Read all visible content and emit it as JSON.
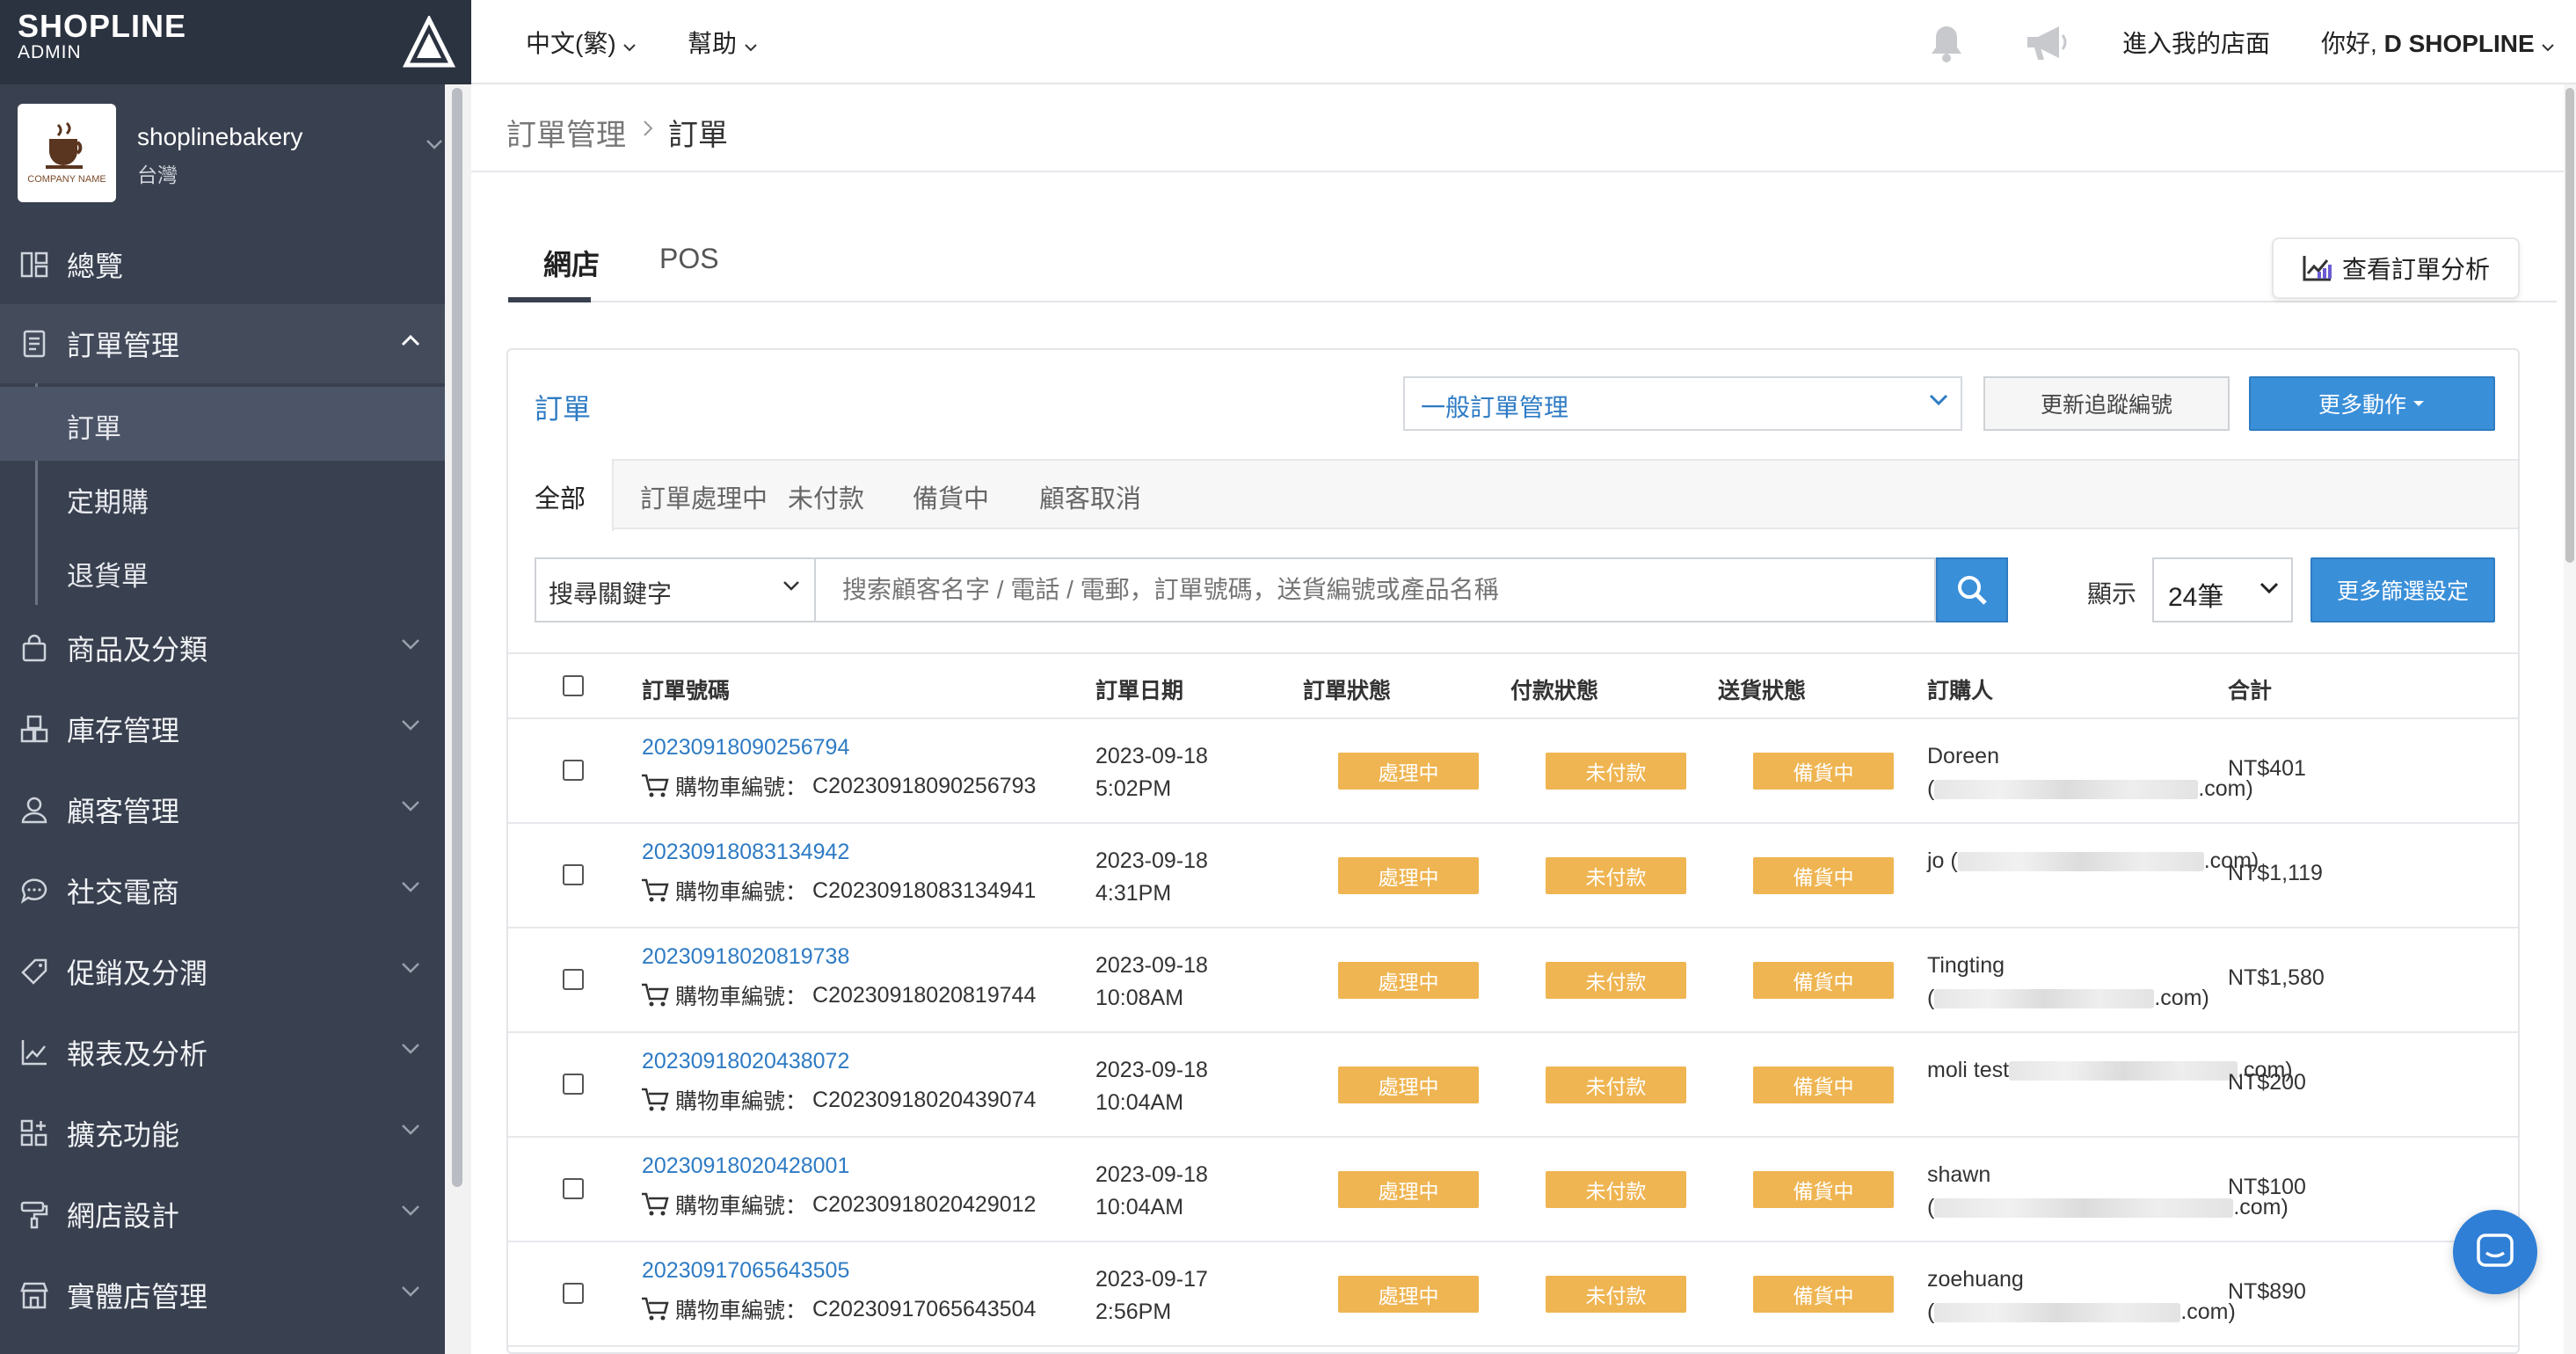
{
  "brand": {
    "name": "SHOPLINE",
    "sub": "ADMIN"
  },
  "store": {
    "name": "shoplinebakery",
    "region": "台灣",
    "logo_caption": "COMPANY NAME"
  },
  "sidebar": {
    "items": [
      {
        "label": "總覽",
        "icon": "dashboard-icon"
      },
      {
        "label": "訂單管理",
        "icon": "orders-icon"
      },
      {
        "label": "商品及分類",
        "icon": "bag-icon"
      },
      {
        "label": "庫存管理",
        "icon": "inventory-icon"
      },
      {
        "label": "顧客管理",
        "icon": "customer-icon"
      },
      {
        "label": "社交電商",
        "icon": "chat-icon"
      },
      {
        "label": "促銷及分潤",
        "icon": "tag-icon"
      },
      {
        "label": "報表及分析",
        "icon": "chart-icon"
      },
      {
        "label": "擴充功能",
        "icon": "apps-icon"
      },
      {
        "label": "網店設計",
        "icon": "paint-roller-icon"
      },
      {
        "label": "實體店管理",
        "icon": "store-icon"
      }
    ],
    "sub_items": [
      {
        "label": "訂單"
      },
      {
        "label": "定期購"
      },
      {
        "label": "退貨單"
      }
    ]
  },
  "topbar": {
    "language": "中文(繁)",
    "help": "幫助",
    "visit_store": "進入我的店面",
    "greeting_prefix": "你好,",
    "greeting_name": "D SHOPLINE"
  },
  "breadcrumb": {
    "parent": "訂單管理",
    "current": "訂單"
  },
  "channel_tabs": {
    "web": "網店",
    "pos": "POS"
  },
  "analysis_button": "查看訂單分析",
  "panel": {
    "title": "訂單",
    "mgmt_select": "一般訂單管理",
    "track_button": "更新追蹤編號",
    "more_actions": "更多動作",
    "status_tabs": [
      "全部",
      "訂單處理中",
      "未付款",
      "備貨中",
      "顧客取消"
    ],
    "search": {
      "keyword_select": "搜尋關鍵字",
      "placeholder": "搜索顧客名字 / 電話 / 電郵，訂單號碼，送貨編號或產品名稱",
      "show_label": "顯示",
      "page_size": "24筆",
      "filter_button": "更多篩選設定"
    }
  },
  "table": {
    "headers": {
      "order_no": "訂單號碼",
      "date": "訂單日期",
      "order_status": "訂單狀態",
      "payment_status": "付款狀態",
      "delivery_status": "送貨狀態",
      "buyer": "訂購人",
      "total": "合計"
    },
    "cart_prefix": "購物車編號：",
    "rows": [
      {
        "order_no": "20230918090256794",
        "cart_no": "C20230918090256793",
        "date": "2023-09-18",
        "time": "5:02PM",
        "order_status": "處理中",
        "payment_status": "未付款",
        "delivery_status": "備貨中",
        "buyer_name": "Doreen",
        "email_head": "(",
        "email_tail": ".com)",
        "total": "NT$401"
      },
      {
        "order_no": "20230918083134942",
        "cart_no": "C20230918083134941",
        "date": "2023-09-18",
        "time": "4:31PM",
        "order_status": "處理中",
        "payment_status": "未付款",
        "delivery_status": "備貨中",
        "buyer_name": "jo (",
        "email_head": "",
        "email_tail": ".com)",
        "total": "NT$1,119"
      },
      {
        "order_no": "20230918020819738",
        "cart_no": "C20230918020819744",
        "date": "2023-09-18",
        "time": "10:08AM",
        "order_status": "處理中",
        "payment_status": "未付款",
        "delivery_status": "備貨中",
        "buyer_name": "Tingting",
        "email_head": "(",
        "email_tail": ".com)",
        "total": "NT$1,580"
      },
      {
        "order_no": "20230918020438072",
        "cart_no": "C20230918020439074",
        "date": "2023-09-18",
        "time": "10:04AM",
        "order_status": "處理中",
        "payment_status": "未付款",
        "delivery_status": "備貨中",
        "buyer_name": "moli test",
        "email_head": "",
        "email_tail": ".com)",
        "total": "NT$200"
      },
      {
        "order_no": "20230918020428001",
        "cart_no": "C20230918020429012",
        "date": "2023-09-18",
        "time": "10:04AM",
        "order_status": "處理中",
        "payment_status": "未付款",
        "delivery_status": "備貨中",
        "buyer_name": "shawn",
        "email_head": "(",
        "email_tail": ".com)",
        "total": "NT$100"
      },
      {
        "order_no": "20230917065643505",
        "cart_no": "C20230917065643504",
        "date": "2023-09-17",
        "time": "2:56PM",
        "order_status": "處理中",
        "payment_status": "未付款",
        "delivery_status": "備貨中",
        "buyer_name": "zoehuang",
        "email_head": "(",
        "email_tail": ".com)",
        "total": "NT$890"
      }
    ]
  },
  "colors": {
    "sidebar_bg": "#39404f",
    "accent_blue": "#3a8fd9",
    "link_blue": "#2e7bc4",
    "status_badge": "#efb552"
  }
}
